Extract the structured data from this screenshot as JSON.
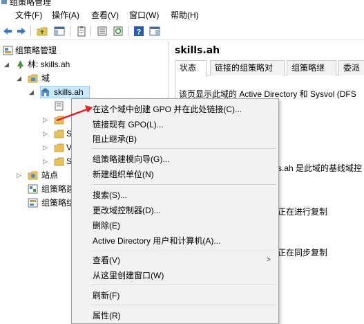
{
  "window": {
    "title": "组策略管理"
  },
  "menubar": {
    "items": [
      "文件(F)",
      "操作(A)",
      "查看(V)",
      "窗口(W)",
      "帮助(H)"
    ]
  },
  "toolbar": {
    "buttons": [
      "back-icon",
      "forward-icon",
      "folder-up-icon",
      "show-hide-tree-icon",
      "clipboard-icon",
      "export-list-icon",
      "refresh-icon",
      "help-icon",
      "properties-icon"
    ]
  },
  "tree": {
    "root": "组策略管理",
    "forest": "林: skills.ah",
    "domains": "域",
    "domain": "skills.ah",
    "sites": "站点",
    "gpo_modeling": "组策略建模",
    "gpo_results": "组策略结果",
    "partial": [
      "S",
      "V",
      "S"
    ]
  },
  "right_pane": {
    "title": "skills.ah",
    "tabs": [
      "状态",
      "链接的组策略对象",
      "组策略继承",
      "委派"
    ],
    "text1": "该页显示此域的 Active Directory 和 Sysvol (DFS",
    "text2": "s.ah 是此域的基线域控",
    "text3": "正在进行复制",
    "text4": "正在同步复制"
  },
  "context_menu": {
    "items": [
      "在这个域中创建 GPO 并在此处链接(C)...",
      "链接现有 GPO(L)...",
      "阻止继承(B)",
      "组策略建模向导(G)...",
      "新建组织单位(N)",
      "搜索(S)...",
      "更改域控制器(D)...",
      "删除(E)",
      "Active Directory 用户和计算机(A)...",
      "查看(V)",
      "从这里创建窗口(W)",
      "刷新(F)",
      "属性(R)"
    ],
    "submenu_arrow": ">"
  },
  "colors": {
    "selection": "#cce8ff",
    "annotation_arrow": "#e02020",
    "menu_bg": "#f2f2f2"
  }
}
